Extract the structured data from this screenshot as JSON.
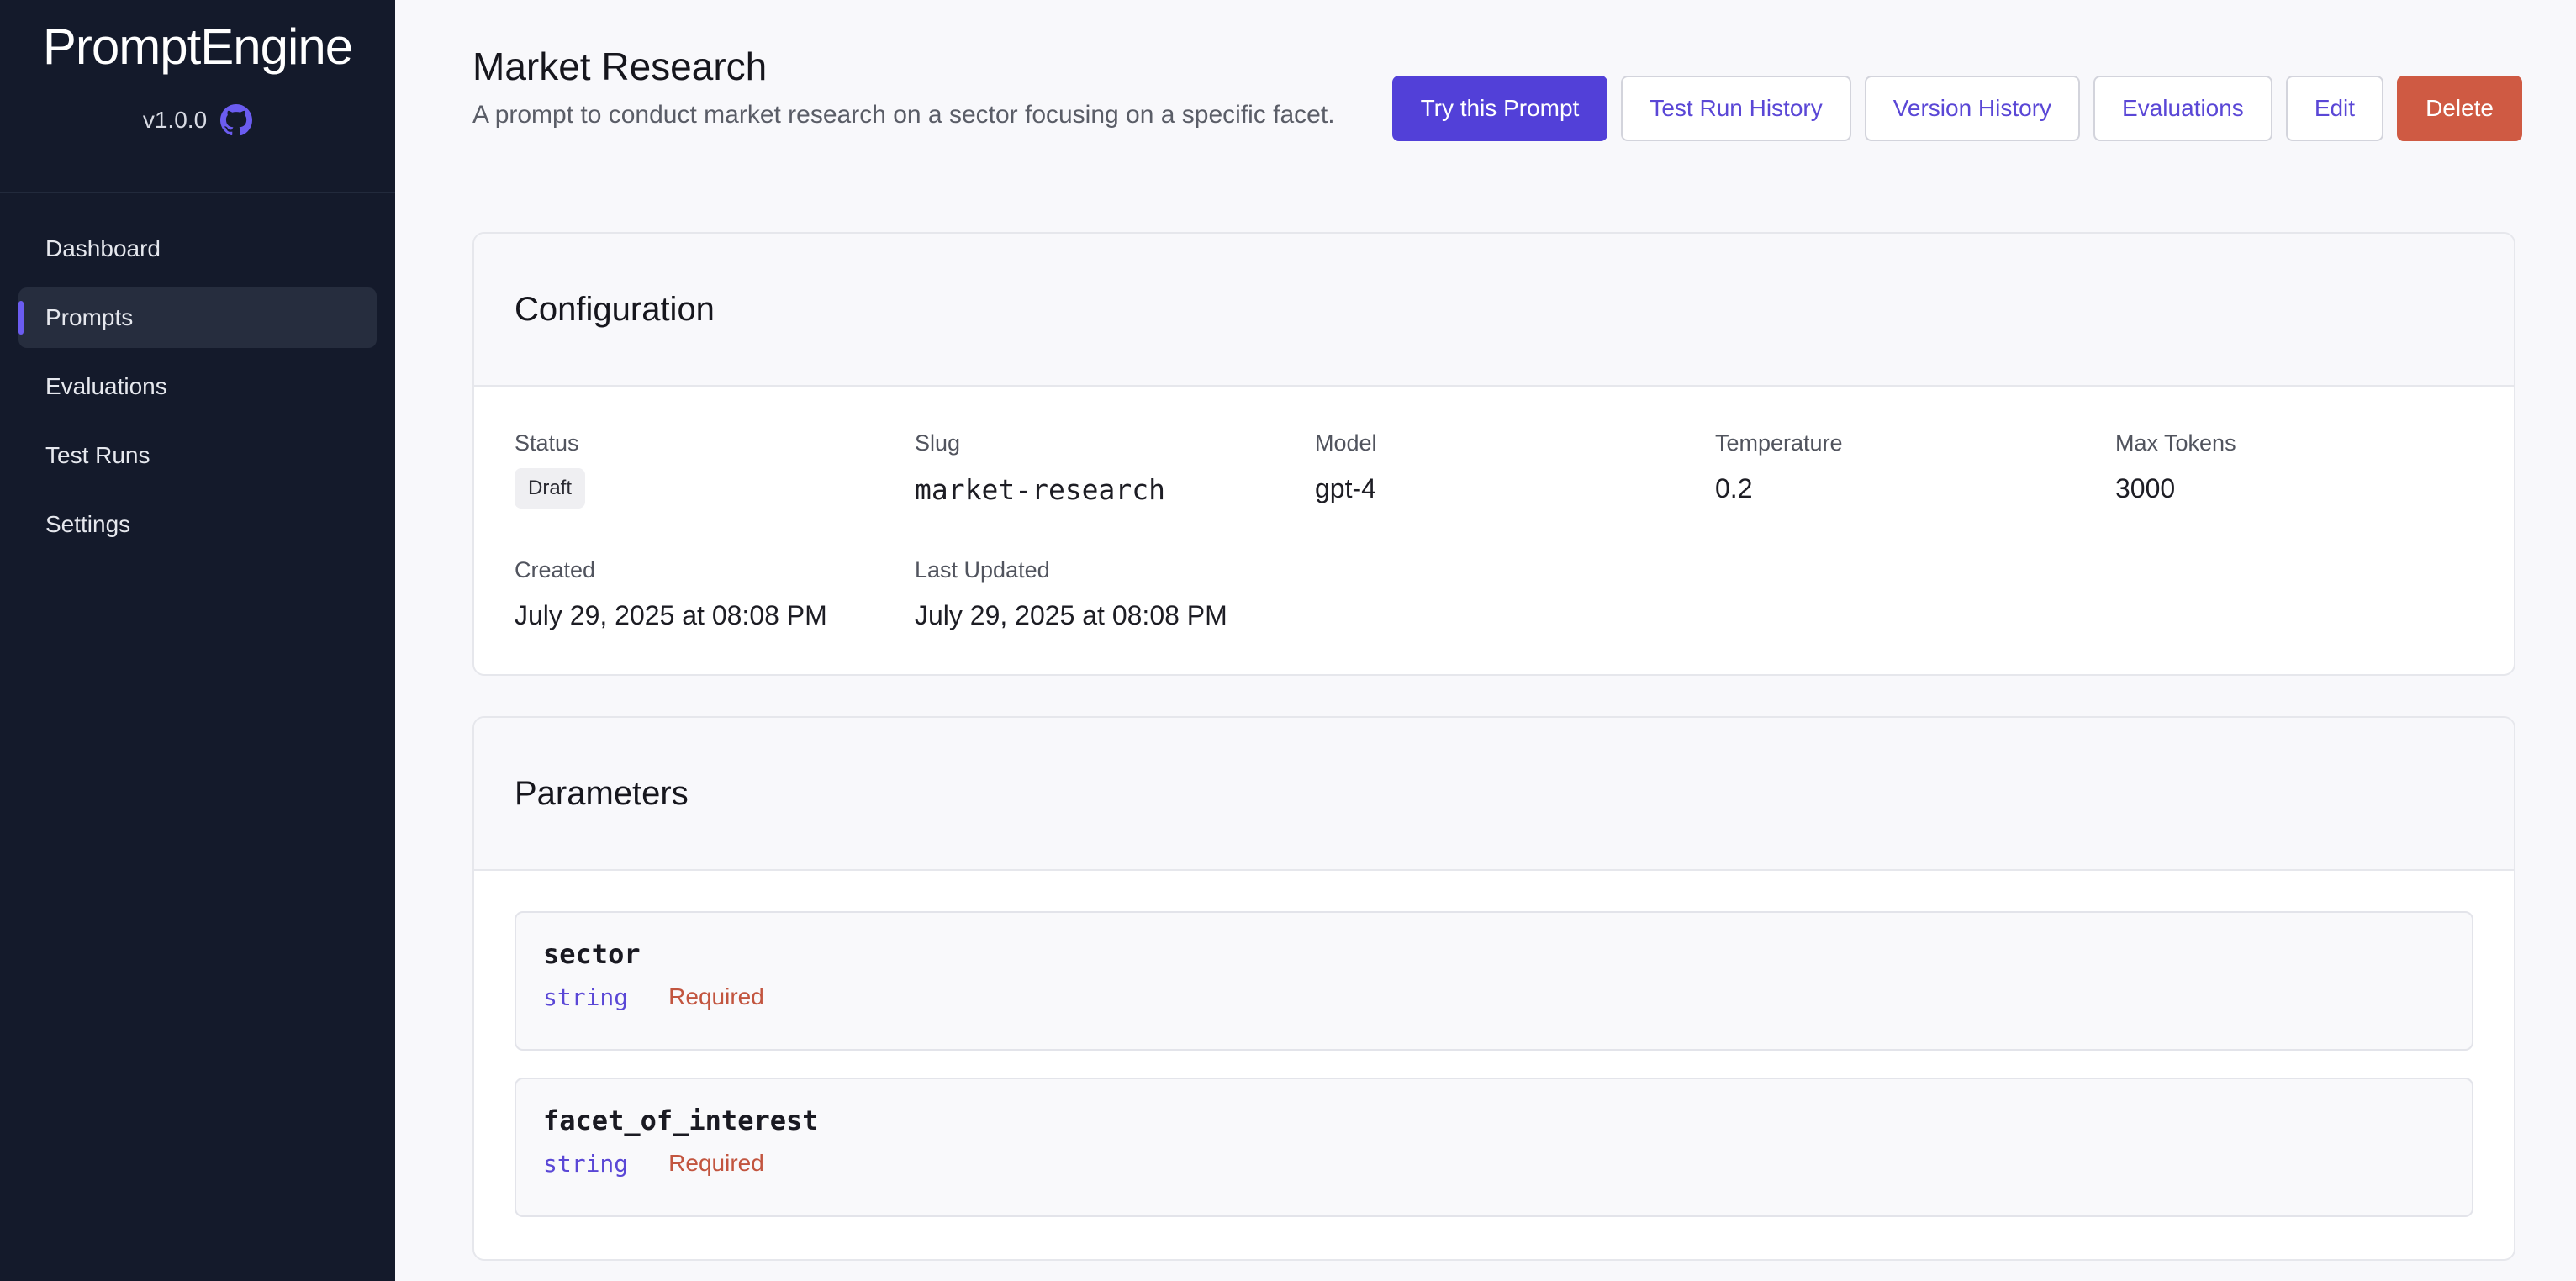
{
  "app": {
    "brand": "PromptEngine",
    "version": "v1.0.0",
    "github_icon": "github-icon"
  },
  "sidebar": {
    "items": [
      {
        "label": "Dashboard",
        "active": false
      },
      {
        "label": "Prompts",
        "active": true
      },
      {
        "label": "Evaluations",
        "active": false
      },
      {
        "label": "Test Runs",
        "active": false
      },
      {
        "label": "Settings",
        "active": false
      }
    ]
  },
  "page": {
    "title": "Market Research",
    "description": "A prompt to conduct market research on a sector focusing on a specific facet."
  },
  "actions": {
    "try": "Try this Prompt",
    "test_history": "Test Run History",
    "version_history": "Version History",
    "evaluations": "Evaluations",
    "edit": "Edit",
    "delete": "Delete"
  },
  "configuration": {
    "title": "Configuration",
    "status_label": "Status",
    "status_value": "Draft",
    "slug_label": "Slug",
    "slug_value": "market-research",
    "model_label": "Model",
    "model_value": "gpt-4",
    "temperature_label": "Temperature",
    "temperature_value": "0.2",
    "max_tokens_label": "Max Tokens",
    "max_tokens_value": "3000",
    "created_label": "Created",
    "created_value": "July 29, 2025 at 08:08 PM",
    "updated_label": "Last Updated",
    "updated_value": "July 29, 2025 at 08:08 PM"
  },
  "parameters": {
    "title": "Parameters",
    "items": [
      {
        "name": "sector",
        "type": "string",
        "required": "Required"
      },
      {
        "name": "facet_of_interest",
        "type": "string",
        "required": "Required"
      }
    ]
  },
  "colors": {
    "sidebar_bg": "#141a2b",
    "accent": "#5240d8",
    "danger": "#cf5a43"
  }
}
